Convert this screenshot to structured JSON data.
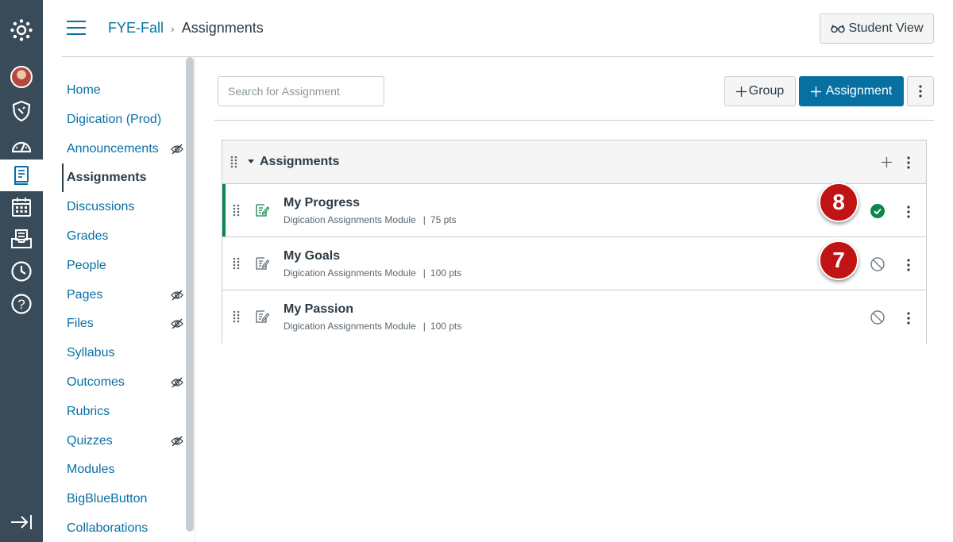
{
  "header": {
    "course_link": "FYE-Fall",
    "current_page": "Assignments",
    "student_view_label": "Student View"
  },
  "course_nav": {
    "items": [
      {
        "label": "Home",
        "hidden": false
      },
      {
        "label": "Digication (Prod)",
        "hidden": false
      },
      {
        "label": "Announcements",
        "hidden": true
      },
      {
        "label": "Assignments",
        "hidden": false,
        "active": true
      },
      {
        "label": "Discussions",
        "hidden": false
      },
      {
        "label": "Grades",
        "hidden": false
      },
      {
        "label": "People",
        "hidden": false
      },
      {
        "label": "Pages",
        "hidden": true
      },
      {
        "label": "Files",
        "hidden": true
      },
      {
        "label": "Syllabus",
        "hidden": false
      },
      {
        "label": "Outcomes",
        "hidden": true
      },
      {
        "label": "Rubrics",
        "hidden": false
      },
      {
        "label": "Quizzes",
        "hidden": true
      },
      {
        "label": "Modules",
        "hidden": false
      },
      {
        "label": "BigBlueButton",
        "hidden": false
      },
      {
        "label": "Collaborations",
        "hidden": false
      }
    ]
  },
  "toolbar": {
    "search_placeholder": "Search for Assignment",
    "group_label": "Group",
    "assignment_label": "Assignment"
  },
  "assignment_group": {
    "title": "Assignments",
    "assignments": [
      {
        "name": "My Progress",
        "module": "Digication Assignments Module",
        "points": "75 pts",
        "status": "published"
      },
      {
        "name": "My Goals",
        "module": "Digication Assignments Module",
        "points": "100 pts",
        "status": "unpublished"
      },
      {
        "name": "My Passion",
        "module": "Digication Assignments Module",
        "points": "100 pts",
        "status": "unpublished"
      }
    ]
  },
  "callouts": [
    {
      "number": "8"
    },
    {
      "number": "7"
    }
  ],
  "colors": {
    "link": "#0770a3",
    "nav_bg": "#394b58",
    "primary_button": "#0770a3",
    "published": "#0b874b",
    "callout": "#c01313"
  },
  "icons": {
    "global_nav": [
      "canvas-logo-icon",
      "account-avatar",
      "admin-shield-icon",
      "dashboard-icon",
      "courses-icon",
      "calendar-icon",
      "inbox-icon",
      "history-icon",
      "help-icon",
      "collapse-nav-icon"
    ],
    "assignment": "assignment-icon",
    "published": "published-check-icon",
    "unpublished": "unpublished-icon",
    "hidden": "eye-slash-icon"
  }
}
